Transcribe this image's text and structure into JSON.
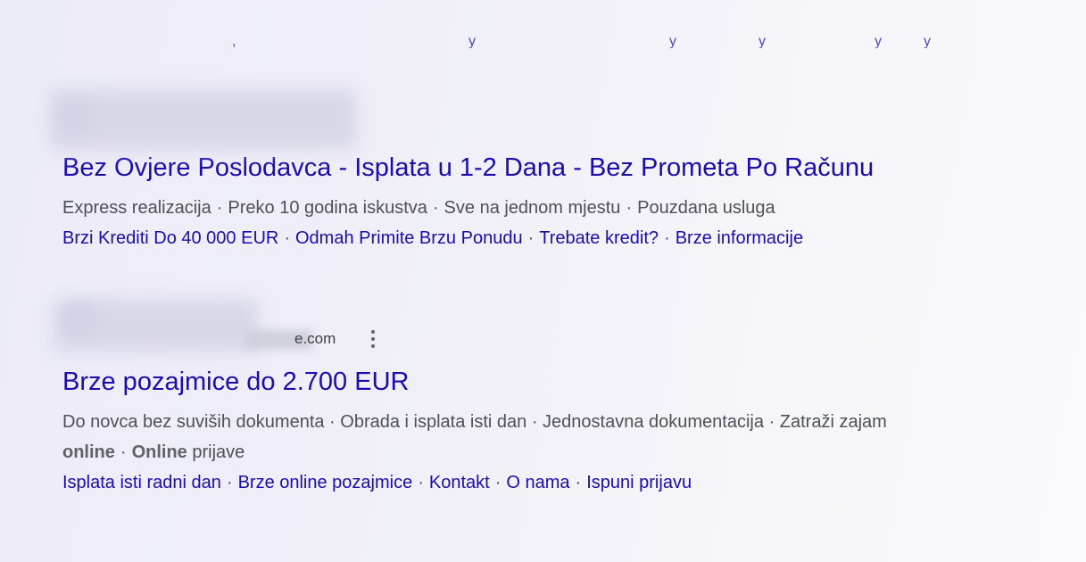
{
  "results": [
    {
      "title": "Bez Ovjere Poslodavca - Isplata u 1-2 Dana - Bez Prometa Po Računu",
      "description_parts": [
        "Express realizacija",
        "Preko 10 godina iskustva",
        "Sve na jednom mjestu",
        "Pouzdana usluga"
      ],
      "sitelinks": [
        "Brzi Krediti Do 40 000 EUR",
        "Odmah Primite Brzu Ponudu",
        "Trebate kredit?",
        "Brze informacije"
      ]
    },
    {
      "display_url_suffix": "e.com",
      "title": "Brze pozajmice do 2.700 EUR",
      "description_line1": "Do novca bez suviših dokumenta · Obrada i isplata isti dan · Jednostavna dokumentacija · Zatraži zajam",
      "description_bold1": "online",
      "description_bold2": "Online",
      "description_tail": "prijave",
      "sitelinks": [
        "Isplata isti radni dan",
        "Brze online pozajmice",
        "Kontakt",
        "O nama",
        "Ispuni prijavu"
      ]
    }
  ],
  "separator": "·",
  "colors": {
    "link": "#1a0dab",
    "text": "#4d5156"
  },
  "icons": {
    "more_options": "vertical-three-dots"
  }
}
